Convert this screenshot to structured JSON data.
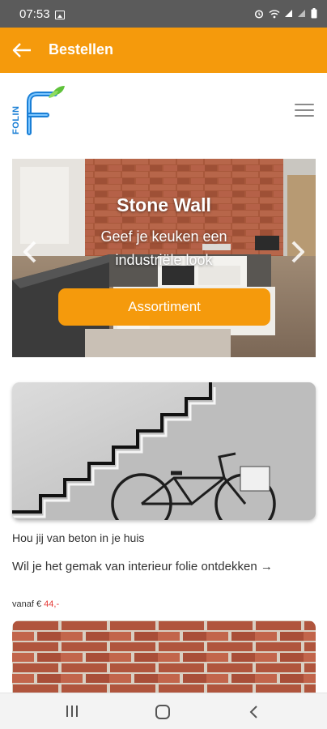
{
  "status_bar": {
    "time": "07:53"
  },
  "app_bar": {
    "title": "Bestellen"
  },
  "logo": {
    "text": "FOLIN",
    "letter": "F"
  },
  "hero": {
    "title": "Stone Wall",
    "subtitle": "Geef je keuken een industriële look",
    "button_label": "Assortiment"
  },
  "card": {
    "caption": "Hou jij van beton in je huis",
    "headline": "Wil je het gemak van interieur folie ontdekken →",
    "price_prefix": "vanaf €",
    "price_amount": "44,-"
  },
  "colors": {
    "accent": "#f59a0c",
    "price": "#e53935",
    "logo_blue": "#1a7fd6",
    "logo_green": "#5fc23b"
  },
  "icons": [
    "back-arrow-icon",
    "hamburger-icon",
    "chevron-left-icon",
    "chevron-right-icon",
    "recent-apps-icon",
    "home-icon",
    "back-icon"
  ]
}
